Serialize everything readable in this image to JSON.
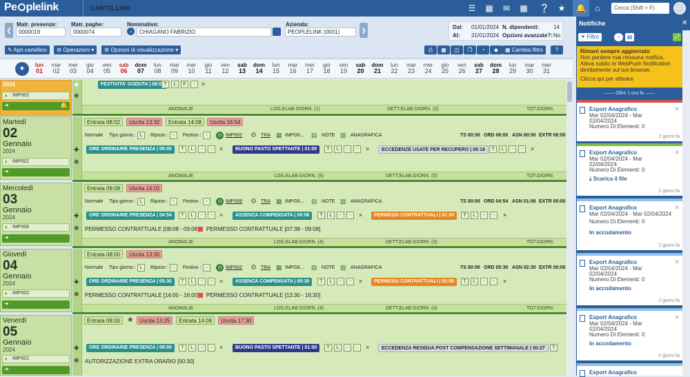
{
  "app": {
    "brand_pre": "Pe",
    "brand_post": "plelink",
    "title": "CARTELLINO",
    "search_placeholder": "Cerca (Shift + F)"
  },
  "icons": {
    "top": [
      "list-icon",
      "calendar-icon",
      "mail-icon",
      "grid-icon",
      "help-icon",
      "star-icon",
      "bell-icon",
      "home-icon"
    ]
  },
  "filters": {
    "matr_presenze_label": "Matr. presenze:",
    "matr_presenze": "0000019",
    "matr_paghe_label": "Matr. paghe:",
    "matr_paghe": "0000074",
    "nominativo_label": "Nominativo:",
    "nominativo": "CHIAGANO FABRIZIO",
    "azienda_label": "Azienda:",
    "azienda": "PEOPLELINK (0001)",
    "dal_label": "Dal:",
    "dal": "01/01/2024",
    "al_label": "Al:",
    "al": "31/01/2024",
    "ndip_label": "N. dipendenti:",
    "ndip": "14",
    "opz_label": "Opzioni avanzate?:",
    "opz": "No"
  },
  "toolbar": {
    "apri": "Apri cartellino",
    "operazioni": "Operazioni",
    "opzioni": "Opzioni di visualizzazione",
    "cambia": "Cambia filtro"
  },
  "dates": [
    {
      "d": "lun",
      "n": "01",
      "t": "red"
    },
    {
      "d": "mar",
      "n": "02",
      "t": ""
    },
    {
      "d": "mer",
      "n": "03",
      "t": ""
    },
    {
      "d": "gio",
      "n": "04",
      "t": ""
    },
    {
      "d": "ven",
      "n": "05",
      "t": ""
    },
    {
      "d": "sab",
      "n": "06",
      "t": "red"
    },
    {
      "d": "dom",
      "n": "07",
      "t": "we"
    },
    {
      "d": "lun",
      "n": "08",
      "t": ""
    },
    {
      "d": "mar",
      "n": "09",
      "t": ""
    },
    {
      "d": "mer",
      "n": "10",
      "t": ""
    },
    {
      "d": "gio",
      "n": "11",
      "t": ""
    },
    {
      "d": "ven",
      "n": "12",
      "t": ""
    },
    {
      "d": "sab",
      "n": "13",
      "t": "we"
    },
    {
      "d": "dom",
      "n": "14",
      "t": "we"
    },
    {
      "d": "lun",
      "n": "15",
      "t": ""
    },
    {
      "d": "mar",
      "n": "16",
      "t": ""
    },
    {
      "d": "mer",
      "n": "17",
      "t": ""
    },
    {
      "d": "gio",
      "n": "18",
      "t": ""
    },
    {
      "d": "ven",
      "n": "19",
      "t": ""
    },
    {
      "d": "sab",
      "n": "20",
      "t": "we"
    },
    {
      "d": "dom",
      "n": "21",
      "t": "we"
    },
    {
      "d": "lun",
      "n": "22",
      "t": ""
    },
    {
      "d": "mar",
      "n": "23",
      "t": ""
    },
    {
      "d": "mer",
      "n": "24",
      "t": ""
    },
    {
      "d": "gio",
      "n": "25",
      "t": ""
    },
    {
      "d": "ven",
      "n": "26",
      "t": ""
    },
    {
      "d": "sab",
      "n": "27",
      "t": "we"
    },
    {
      "d": "dom",
      "n": "28",
      "t": "we"
    },
    {
      "d": "lun",
      "n": "29",
      "t": ""
    },
    {
      "d": "mar",
      "n": "30",
      "t": ""
    },
    {
      "d": "mer",
      "n": "31",
      "t": ""
    }
  ],
  "common": {
    "anomalie": "ANOMALIE",
    "normale": "Normale",
    "tipo": "Tipo giorno :",
    "riposo": "Riposo :",
    "festivo": "Festivo :",
    "tra": "TRA",
    "note": "NOTE",
    "anag": "ANAGRAFICA",
    "t": "T",
    "l": "L",
    "f": "F",
    "dash": "-",
    "totgiorn": "TOT.GIORN.",
    "x": "×"
  },
  "day0": {
    "year": "2024",
    "imp": "IMP002",
    "festivita": "FESTIVITA' GODUTA | 08:00",
    "log": "LOG.ELAB.GIORN. (1)",
    "dett": "DETT.ELAB.GIORN. (2)"
  },
  "day1": {
    "wd": "Martedì",
    "dn": "02",
    "mo": "Gennaio",
    "yr": "2024",
    "imp": "IMP002",
    "entrata1": "Entrata 08:02",
    "uscita1": "Uscita 13:32",
    "entrata2": "Entrata 14:08",
    "uscita2": "Uscita 16:54",
    "impcode": "IMP002",
    "impg": "IMPG6...",
    "ts": "TS 00:00",
    "ord": "ORD 08:00",
    "asn": "ASN 00:00",
    "extr": "EXTR 00:00",
    "p1": "ORE ORDINARIE PRESENZA | 08:00",
    "p2": "BUONO PASTO SPETTANTE | 01:00",
    "p3": "ECCEDENZE USATE PER RECUPERO | 00:16",
    "log": "LOG.ELAB.GIORN. (5)",
    "dett": "DETT.ELAB.GIORN. (5)"
  },
  "day2": {
    "wd": "Mercoledì",
    "dn": "03",
    "mo": "Gennaio",
    "yr": "2024",
    "imp": "IMP006",
    "entrata1": "Entrata 09:08",
    "uscita1": "Uscita 14:02",
    "impcode": "IMP006",
    "impg": "IMPG6...",
    "ts": "TS 00:00",
    "ord": "ORD 04:54",
    "asn": "ASN 01:06",
    "extr": "EXTR 00:00",
    "p1": "ORE ORDINARIE PRESENZA | 04:54",
    "p2": "ASSENZA COMPENSATA | 00:06",
    "p3": "PERMESSI CONTRATTUALI | 01:00",
    "perm1": "PERMESSO CONTRATTUALE [08:08 - 09:08]",
    "perm2": "PERMESSO CONTRATTUALE [07:38 - 09:08]",
    "log": "LOG.ELAB.GIORN. (4)",
    "dett": "DETT.ELAB.GIORN. (3)"
  },
  "day3": {
    "wd": "Giovedì",
    "dn": "04",
    "mo": "Gennaio",
    "yr": "2024",
    "imp": "IMP002",
    "entrata1": "Entrata 08:00",
    "uscita1": "Uscita 13:30",
    "impcode": "IMP002",
    "impg": "IMPG6...",
    "ts": "TS 00:00",
    "ord": "ORD 05:30",
    "asn": "ASN 02:30",
    "extr": "EXTR 00:00",
    "p1": "ORE ORDINARIE PRESENZA | 05:30",
    "p2": "ASSENZA COMPENSATA | 00:30",
    "p3": "PERMESSI CONTRATTUALI | 02:00",
    "perm1": "PERMESSO CONTRATTUALE [14:00 - 16:00]",
    "perm2": "PERMESSO CONTRATTUALE [13:30 - 16:30]",
    "log": "LOG.ELAB.GIORN. (4)",
    "dett": "DETT.ELAB.GIORN. (4)"
  },
  "day4": {
    "wd": "Venerdì",
    "dn": "05",
    "mo": "Gennaio",
    "yr": "2024",
    "imp": "IMP002",
    "entrata1": "Entrata 08:00",
    "uscita1": "Uscita 13:25",
    "entrata2": "Entrata 14:08",
    "uscita2": "Uscita 17:30",
    "p1": "ORE ORDINARIE PRESENZA | 08:00",
    "p2": "BUONO PASTO SPETTANTE | 01:00",
    "p3": "ECCEDENZA RESIDUA POST COMPENSAZIONE SETTIMANALE | 00:27",
    "auth": "AUTORIZZAZIONE EXTRA ORARIO [00:30]"
  },
  "notif": {
    "title": "Notifiche",
    "filtro": "Filtro",
    "promo_title": "Rimani sempre aggiornato",
    "promo_text": "Non perdere mai nessuna notifica. Attiva subito le WebPush Notification direttamente sul tuo browser.",
    "promo_link": "Clicca qui per attivare",
    "oltre": "—— Oltre 1 ora fa ——",
    "card_title": "Export Anagrafico",
    "card_l1": "Mar 02/04/2024 - Mar",
    "card_l2": "02/04/2024",
    "card_l3": "Numero Di Elementi: 0",
    "card_l1b": "Mar 02/04/2024 - Mar 02/04/2024",
    "scarica": "Scarica il file",
    "accodamento": "In accodamento",
    "ago": "2 giorni fa"
  },
  "colors": {
    "brand": "#2a5d9a",
    "row_green": "#d6e9b8",
    "accent_yellow": "#f5c21b"
  }
}
